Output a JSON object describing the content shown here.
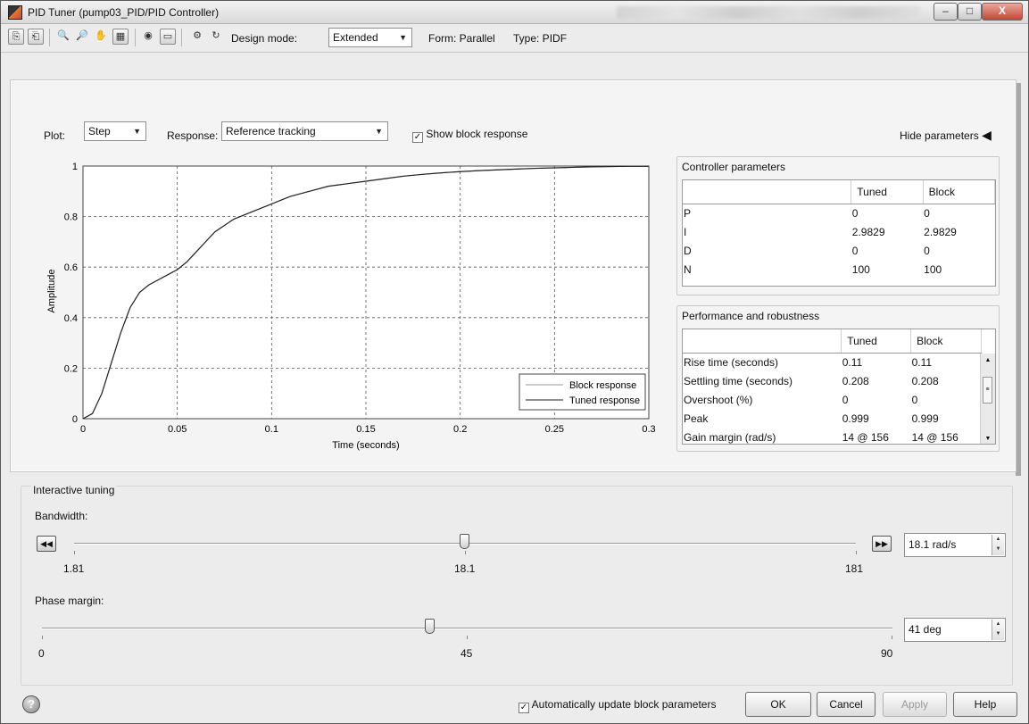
{
  "window": {
    "title": "PID Tuner (pump03_PID/PID Controller)",
    "min_symbol": "–",
    "max_symbol": "□",
    "close_symbol": "X"
  },
  "toolbar": {
    "design_mode_label": "Design mode:",
    "design_mode_value": "Extended",
    "form_label": "Form: Parallel",
    "type_label": "Type: PIDF"
  },
  "plot_controls": {
    "plot_label": "Plot:",
    "plot_value": "Step",
    "response_label": "Response:",
    "response_value": "Reference tracking",
    "show_block_response_label": "Show block response",
    "show_block_response_checked": true,
    "hide_parameters_label": "Hide parameters"
  },
  "chart_data": {
    "type": "line",
    "xlabel": "Time (seconds)",
    "ylabel": "Amplitude",
    "xlim": [
      0,
      0.3
    ],
    "ylim": [
      0,
      1
    ],
    "x_ticks": [
      "0",
      "0.05",
      "0.1",
      "0.15",
      "0.2",
      "0.25",
      "0.3"
    ],
    "y_ticks": [
      "0",
      "0.2",
      "0.4",
      "0.6",
      "0.8",
      "1"
    ],
    "grid": true,
    "legend_position": "bottom-right",
    "series": [
      {
        "name": "Block response",
        "color": "#9a9a9a",
        "x": [
          0,
          0.005,
          0.01,
          0.015,
          0.02,
          0.025,
          0.03,
          0.035,
          0.04,
          0.045,
          0.05,
          0.055,
          0.06,
          0.065,
          0.07,
          0.08,
          0.09,
          0.1,
          0.11,
          0.12,
          0.13,
          0.14,
          0.15,
          0.16,
          0.17,
          0.18,
          0.19,
          0.2,
          0.21,
          0.22,
          0.23,
          0.24,
          0.25,
          0.26,
          0.27,
          0.28,
          0.29,
          0.3
        ],
        "y": [
          0,
          0.02,
          0.1,
          0.22,
          0.34,
          0.44,
          0.5,
          0.53,
          0.55,
          0.57,
          0.59,
          0.62,
          0.66,
          0.7,
          0.74,
          0.79,
          0.82,
          0.85,
          0.88,
          0.9,
          0.92,
          0.93,
          0.94,
          0.95,
          0.96,
          0.967,
          0.973,
          0.978,
          0.982,
          0.985,
          0.988,
          0.991,
          0.993,
          0.995,
          0.997,
          0.998,
          0.999,
          0.999
        ]
      },
      {
        "name": "Tuned response",
        "color": "#222222",
        "x": [
          0,
          0.005,
          0.01,
          0.015,
          0.02,
          0.025,
          0.03,
          0.035,
          0.04,
          0.045,
          0.05,
          0.055,
          0.06,
          0.065,
          0.07,
          0.08,
          0.09,
          0.1,
          0.11,
          0.12,
          0.13,
          0.14,
          0.15,
          0.16,
          0.17,
          0.18,
          0.19,
          0.2,
          0.21,
          0.22,
          0.23,
          0.24,
          0.25,
          0.26,
          0.27,
          0.28,
          0.29,
          0.3
        ],
        "y": [
          0,
          0.02,
          0.1,
          0.22,
          0.34,
          0.44,
          0.5,
          0.53,
          0.55,
          0.57,
          0.59,
          0.62,
          0.66,
          0.7,
          0.74,
          0.79,
          0.82,
          0.85,
          0.88,
          0.9,
          0.92,
          0.93,
          0.94,
          0.95,
          0.96,
          0.967,
          0.973,
          0.978,
          0.982,
          0.985,
          0.988,
          0.991,
          0.993,
          0.995,
          0.997,
          0.998,
          0.999,
          0.999
        ]
      }
    ]
  },
  "controller_parameters": {
    "title": "Controller parameters",
    "columns": [
      "",
      "Tuned",
      "Block"
    ],
    "rows": [
      [
        "P",
        "0",
        "0"
      ],
      [
        "I",
        "2.9829",
        "2.9829"
      ],
      [
        "D",
        "0",
        "0"
      ],
      [
        "N",
        "100",
        "100"
      ]
    ]
  },
  "performance": {
    "title": "Performance and robustness",
    "columns": [
      "",
      "Tuned",
      "Block"
    ],
    "rows": [
      [
        "Rise time (seconds)",
        "0.11",
        "0.11"
      ],
      [
        "Settling time (seconds)",
        "0.208",
        "0.208"
      ],
      [
        "Overshoot (%)",
        "0",
        "0"
      ],
      [
        "Peak",
        "0.999",
        "0.999"
      ],
      [
        "Gain margin (rad/s)",
        "14 @ 156",
        "14 @ 156"
      ]
    ]
  },
  "tuning": {
    "title": "Interactive tuning",
    "bandwidth": {
      "label": "Bandwidth:",
      "min_label": "1.81",
      "mid_label": "18.1",
      "max_label": "181",
      "position": 0.5,
      "value": "18.1 rad/s"
    },
    "phase_margin": {
      "label": "Phase margin:",
      "min_label": "0",
      "mid_label": "45",
      "max_label": "90",
      "position": 0.456,
      "value": "41 deg"
    }
  },
  "footer": {
    "auto_update_label": "Automatically update block parameters",
    "auto_update_checked": true,
    "ok_label": "OK",
    "cancel_label": "Cancel",
    "apply_label": "Apply",
    "help_label": "Help"
  }
}
